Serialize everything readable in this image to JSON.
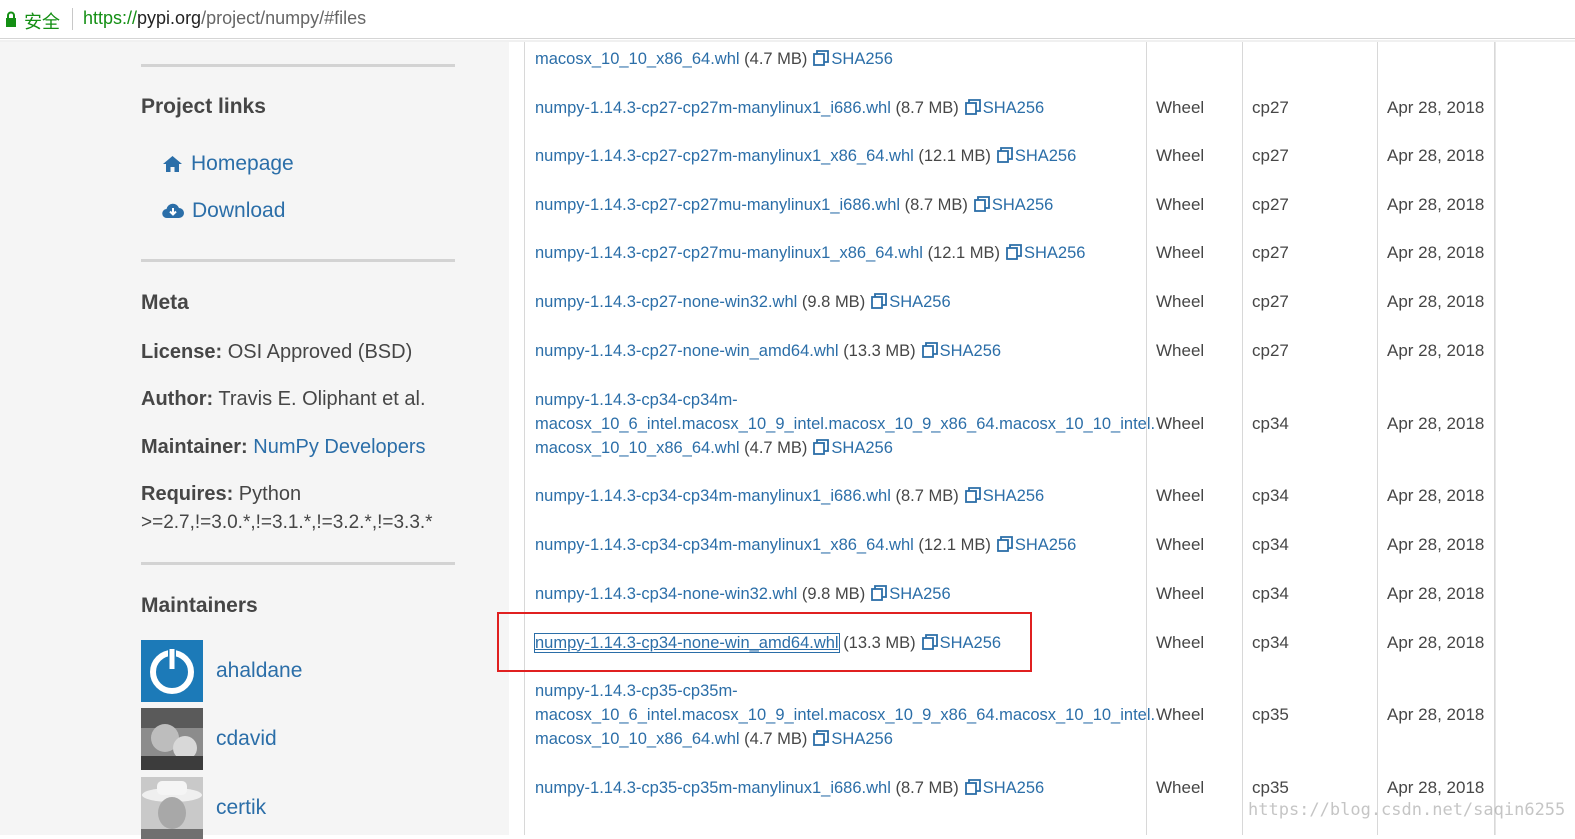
{
  "address_bar": {
    "secure_label": "安全",
    "url_scheme": "https://",
    "url_host": "pypi.org",
    "url_path": "/project/numpy/#files"
  },
  "sidebar": {
    "project_links_heading": "Project links",
    "links": [
      {
        "label": "Homepage",
        "icon": "home-icon"
      },
      {
        "label": "Download",
        "icon": "cloud-download-icon"
      }
    ],
    "meta_heading": "Meta",
    "license_label": "License:",
    "license_value": " OSI Approved (BSD)",
    "author_label": "Author:",
    "author_value": " Travis E. Oliphant et al.",
    "maintainer_label": "Maintainer:",
    "maintainer_value": "NumPy Developers",
    "requires_label": "Requires:",
    "requires_value_1": " Python",
    "requires_value_2": ">=2.7,!=3.0.*,!=3.1.*,!=3.2.*,!=3.3.*",
    "maintainers_heading": "Maintainers",
    "maintainers": [
      {
        "name": "ahaldane"
      },
      {
        "name": "cdavid"
      },
      {
        "name": "certik"
      }
    ]
  },
  "files": {
    "sha_label": "SHA256",
    "rows": [
      {
        "lines": [],
        "link_tail": "macosx_10_10_x86_64.whl",
        "size": "(4.7 MB)",
        "type": "",
        "python": "",
        "date": ""
      },
      {
        "lines": [],
        "link_tail": "numpy-1.14.3-cp27-cp27m-manylinux1_i686.whl",
        "size": "(8.7 MB)",
        "type": "Wheel",
        "python": "cp27",
        "date": "Apr 28, 2018"
      },
      {
        "lines": [],
        "link_tail": "numpy-1.14.3-cp27-cp27m-manylinux1_x86_64.whl",
        "size": "(12.1 MB)",
        "type": "Wheel",
        "python": "cp27",
        "date": "Apr 28, 2018"
      },
      {
        "lines": [],
        "link_tail": "numpy-1.14.3-cp27-cp27mu-manylinux1_i686.whl",
        "size": "(8.7 MB)",
        "type": "Wheel",
        "python": "cp27",
        "date": "Apr 28, 2018"
      },
      {
        "lines": [],
        "link_tail": "numpy-1.14.3-cp27-cp27mu-manylinux1_x86_64.whl",
        "size": "(12.1 MB)",
        "type": "Wheel",
        "python": "cp27",
        "date": "Apr 28, 2018"
      },
      {
        "lines": [],
        "link_tail": "numpy-1.14.3-cp27-none-win32.whl",
        "size": "(9.8 MB)",
        "type": "Wheel",
        "python": "cp27",
        "date": "Apr 28, 2018"
      },
      {
        "lines": [],
        "link_tail": "numpy-1.14.3-cp27-none-win_amd64.whl",
        "size": "(13.3 MB)",
        "type": "Wheel",
        "python": "cp27",
        "date": "Apr 28, 2018"
      },
      {
        "lines": [
          "numpy-1.14.3-cp34-cp34m-",
          "macosx_10_6_intel.macosx_10_9_intel.macosx_10_9_x86_64.macosx_10_10_intel."
        ],
        "link_tail": "macosx_10_10_x86_64.whl",
        "size": "(4.7 MB)",
        "type": "Wheel",
        "python": "cp34",
        "date": "Apr 28, 2018"
      },
      {
        "lines": [],
        "link_tail": "numpy-1.14.3-cp34-cp34m-manylinux1_i686.whl",
        "size": "(8.7 MB)",
        "type": "Wheel",
        "python": "cp34",
        "date": "Apr 28, 2018"
      },
      {
        "lines": [],
        "link_tail": "numpy-1.14.3-cp34-cp34m-manylinux1_x86_64.whl",
        "size": "(12.1 MB)",
        "type": "Wheel",
        "python": "cp34",
        "date": "Apr 28, 2018"
      },
      {
        "lines": [],
        "link_tail": "numpy-1.14.3-cp34-none-win32.whl",
        "size": "(9.8 MB)",
        "type": "Wheel",
        "python": "cp34",
        "date": "Apr 28, 2018"
      },
      {
        "lines": [],
        "link_tail": "numpy-1.14.3-cp34-none-win_amd64.whl",
        "size": "(13.3 MB)",
        "type": "Wheel",
        "python": "cp34",
        "date": "Apr 28, 2018",
        "highlighted": true
      },
      {
        "lines": [
          "numpy-1.14.3-cp35-cp35m-",
          "macosx_10_6_intel.macosx_10_9_intel.macosx_10_9_x86_64.macosx_10_10_intel."
        ],
        "link_tail": "macosx_10_10_x86_64.whl",
        "size": "(4.7 MB)",
        "type": "Wheel",
        "python": "cp35",
        "date": "Apr 28, 2018"
      },
      {
        "lines": [],
        "link_tail": "numpy-1.14.3-cp35-cp35m-manylinux1_i686.whl",
        "size": "(8.7 MB)",
        "type": "Wheel",
        "python": "cp35",
        "date": "Apr 28, 2018"
      },
      {
        "lines": [],
        "link_tail": "",
        "size": "",
        "type": "",
        "python": "",
        "date": ""
      }
    ]
  },
  "watermark": "https://blog.csdn.net/saqin6255",
  "colors": {
    "link": "#2b6ea8",
    "highlight": "#e02020",
    "secure": "#148f14"
  }
}
